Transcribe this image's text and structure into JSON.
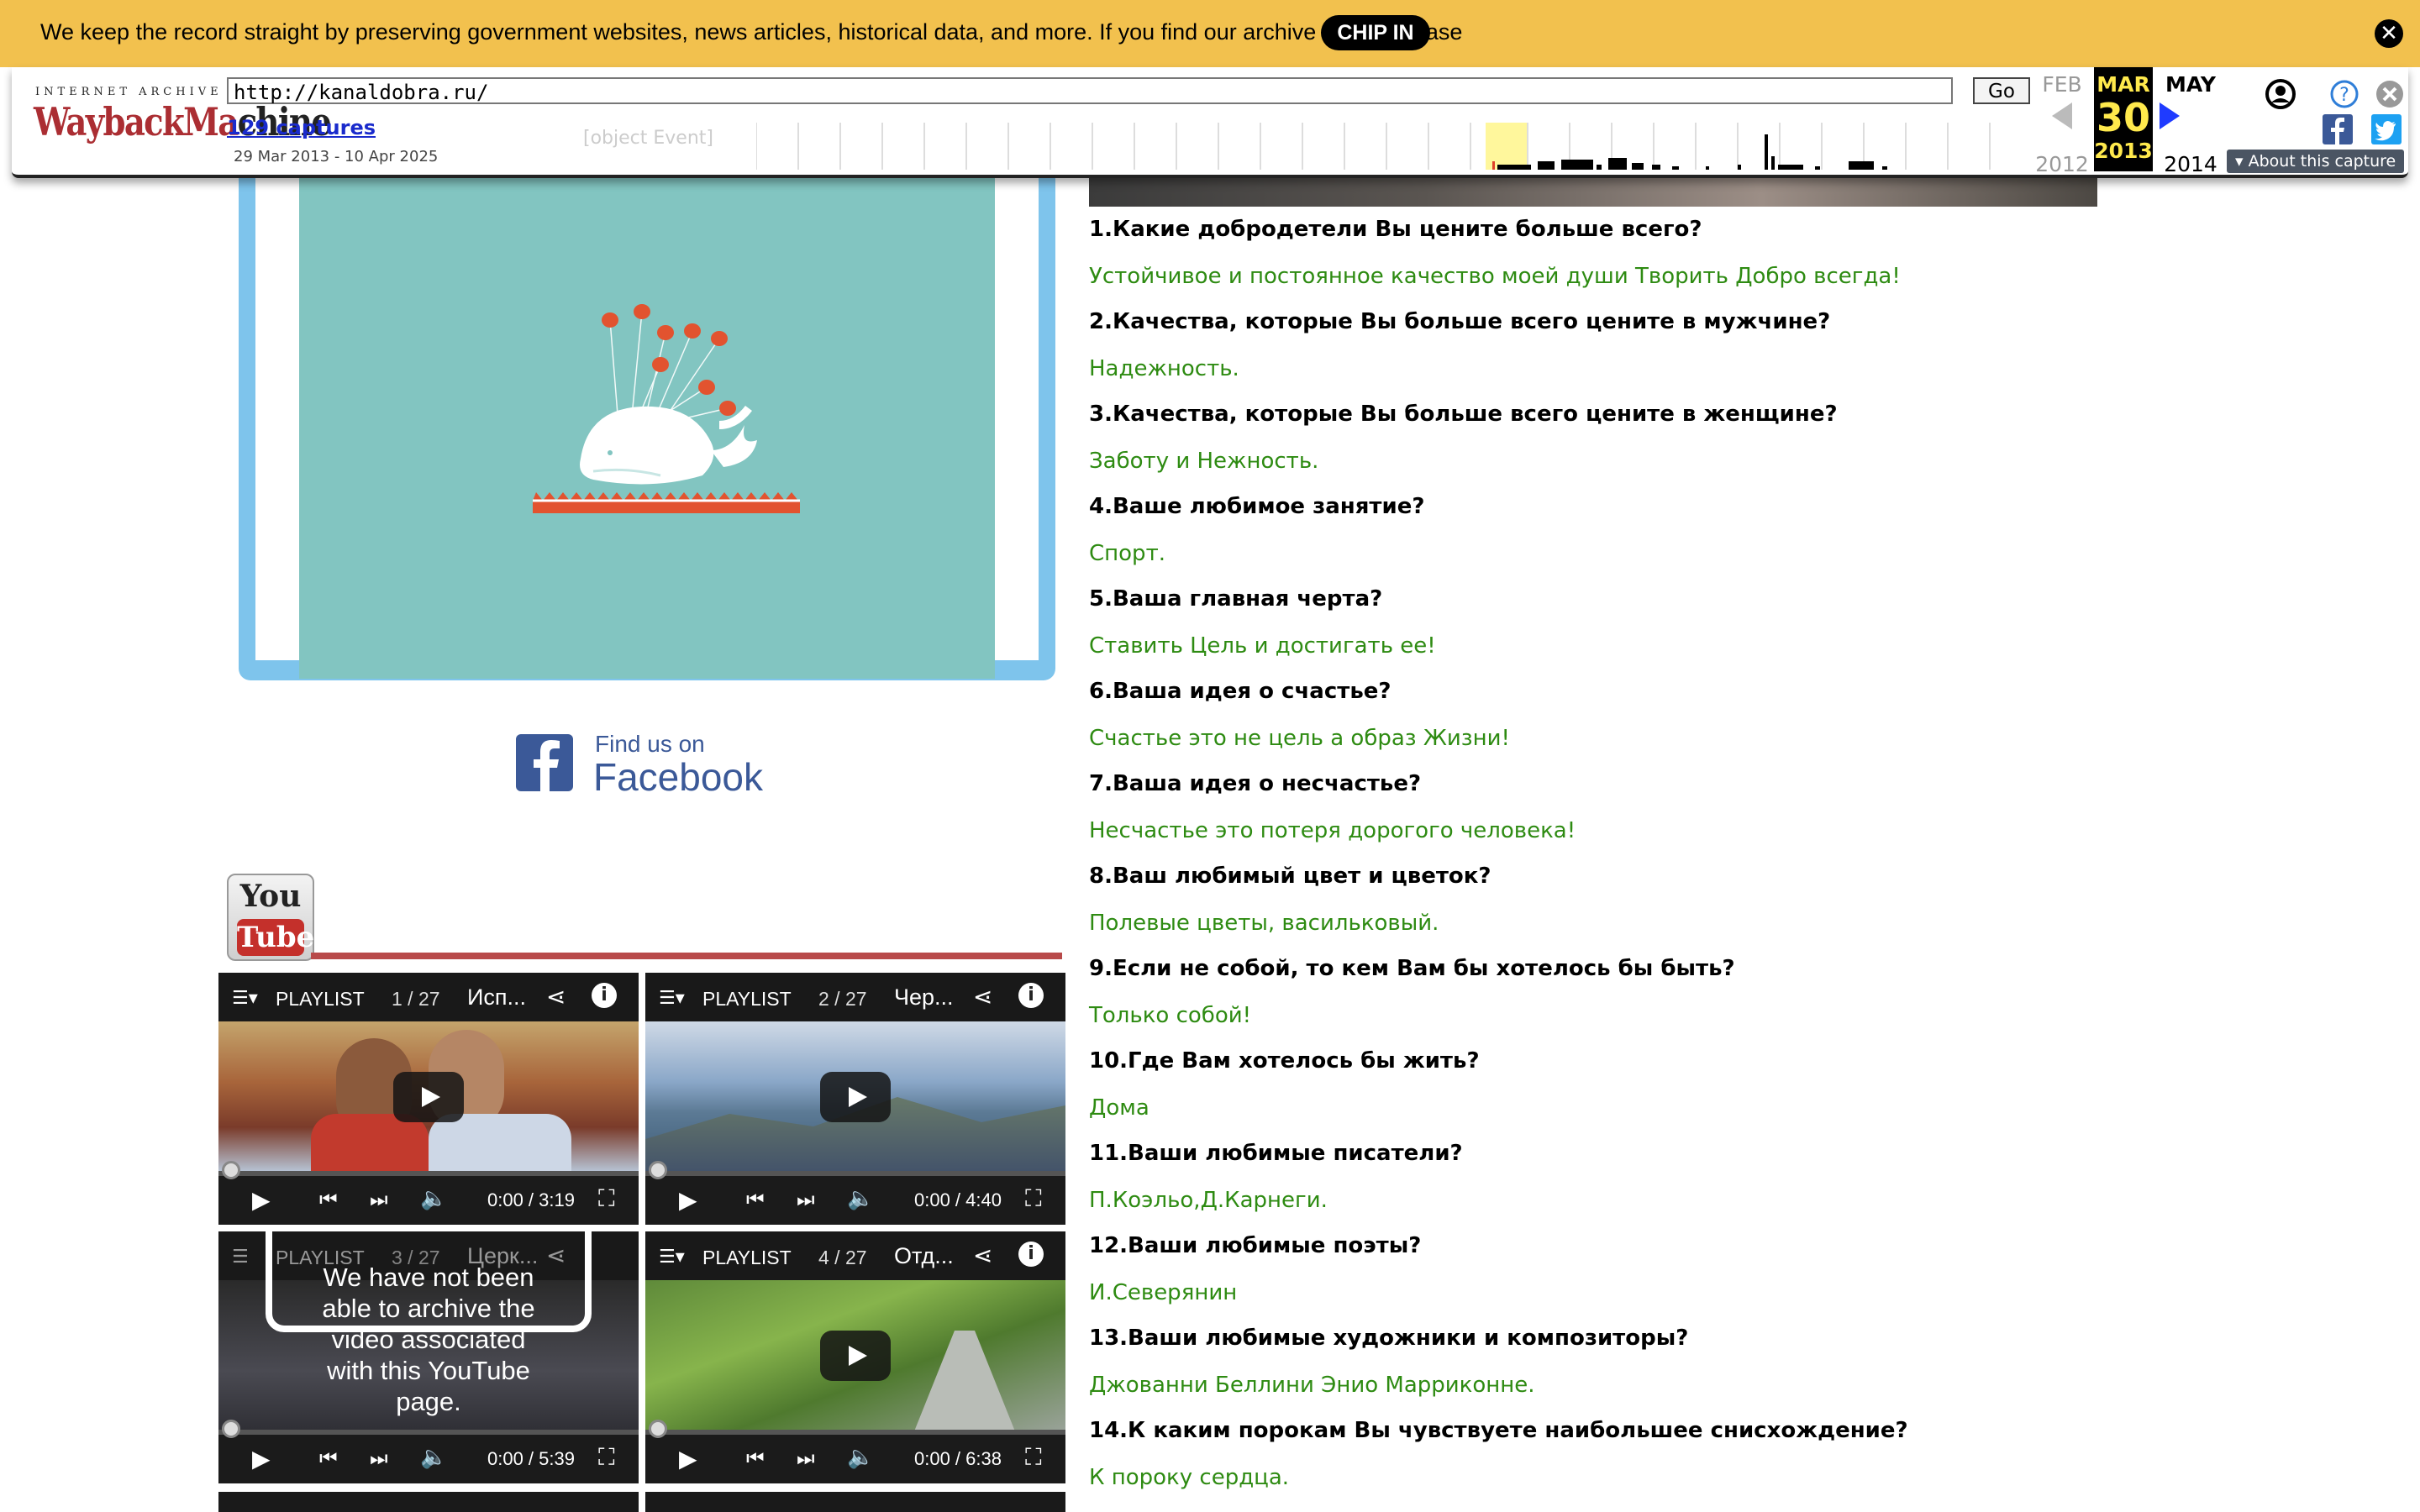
{
  "donate": {
    "message": "We keep the record straight by preserving government websites, news articles, historical data, and more. If you find our archive useful, please",
    "chip_in": "CHIP IN",
    "close": "✕"
  },
  "wayback": {
    "logo_top": "INTERNET ARCHIVE",
    "logo_main_left": "WaybackMa",
    "logo_main_right": "chine",
    "url": "http://kanaldobra.ru/",
    "go": "Go",
    "captures": "129 captures",
    "date_range": "29 Mar 2013 - 10 Apr 2025",
    "object_event": "[object Event]",
    "prev": {
      "month": "FEB",
      "year": "2012"
    },
    "current": {
      "month": "MAR",
      "day": "30",
      "year": "2013"
    },
    "next": {
      "month": "MAY",
      "year": "2014"
    },
    "about": "About this capture",
    "colors": {
      "logo_red": "#ab2e33",
      "cal_yellow": "#ffe94c",
      "arrow_blue": "#1f3bff"
    }
  },
  "sidebar": {
    "facebook_find": "Find us on",
    "facebook_name": "Facebook",
    "youtube_you": "You",
    "youtube_tube": "Tube"
  },
  "videos": [
    {
      "playlist": "PLAYLIST",
      "count": "1 / 27",
      "title": "Исп...",
      "time": "0:00 / 3:19"
    },
    {
      "playlist": "PLAYLIST",
      "count": "2 / 27",
      "title": "Чер...",
      "time": "0:00 / 4:40"
    },
    {
      "playlist": "PLAYLIST",
      "count": "3 / 27",
      "title": "Церк...",
      "time": "0:00 / 5:39",
      "notice": "We have not been able to archive the video associated with this YouTube page."
    },
    {
      "playlist": "PLAYLIST",
      "count": "4 / 27",
      "title": "Отд...",
      "time": "0:00 / 6:38"
    }
  ],
  "interview": [
    {
      "q": "1.Какие добродетели Вы цените больше всего?",
      "a": "Устойчивое и постоянное качество моей души Творить Добро всегда!"
    },
    {
      "q": "2.Качества, которые Вы больше всего цените в мужчине?",
      "a": "Надежность."
    },
    {
      "q": "3.Качества, которые Вы больше всего цените в женщине?",
      "a": "Заботу и Нежность."
    },
    {
      "q": "4.Ваше любимое занятие?",
      "a": "Спорт."
    },
    {
      "q": "5.Ваша главная черта?",
      "a": "Ставить Цель и достигать ее!"
    },
    {
      "q": "6.Ваша идея о счастье?",
      "a": "Счастье это не цель а образ Жизни!"
    },
    {
      "q": "7.Ваша идея о несчастье?",
      "a": "Несчастье это потеря дорогого человека!"
    },
    {
      "q": "8.Ваш любимый цвет и цветок?",
      "a": "Полевые цветы, васильковый."
    },
    {
      "q": "9.Если не собой, то кем Вам бы хотелось бы быть?",
      "a": "Только собой!"
    },
    {
      "q": "10.Где Вам хотелось бы жить?",
      "a": "Дома"
    },
    {
      "q": "11.Ваши любимые писатели?",
      "a": "П.Коэльо,Д.Карнеги."
    },
    {
      "q": "12.Ваши любимые поэты?",
      "a": "И.Северянин"
    },
    {
      "q": "13.Ваши любимые художники и композиторы?",
      "a": "Джованни Беллини Энио Марриконне."
    },
    {
      "q": "14.К каким порокам Вы чувствуете наибольшее снисхождение?",
      "a": "К пороку сердца."
    }
  ]
}
